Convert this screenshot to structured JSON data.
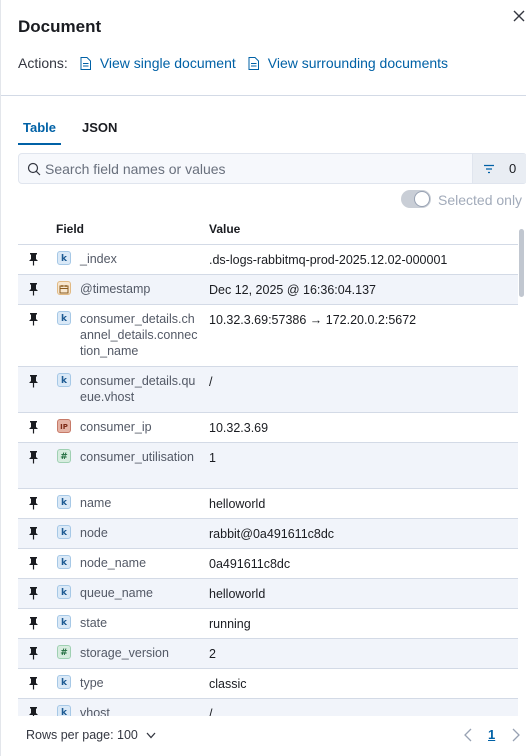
{
  "flyout": {
    "title": "Document",
    "actions_label": "Actions:",
    "view_single": "View single document",
    "view_surrounding": "View surrounding documents"
  },
  "tabs": [
    {
      "label": "Table",
      "active": true
    },
    {
      "label": "JSON",
      "active": false
    }
  ],
  "search": {
    "placeholder": "Search field names or values",
    "filter_count": "0"
  },
  "selected_only_label": "Selected only",
  "table": {
    "headers": {
      "field": "Field",
      "value": "Value"
    },
    "rows": [
      {
        "type_icon": "k",
        "field": "_index",
        "value": ".ds-logs-rabbitmq-prod-2025.12.02-000001"
      },
      {
        "type_icon": "date-icon",
        "field": "@timestamp",
        "value": "Dec 12, 2025 @ 16:36:04.137"
      },
      {
        "type_icon": "k",
        "field": "consumer_details.channel_details.connection_name",
        "value": "10.32.3.69:57386 → 172.20.0.2:5672"
      },
      {
        "type_icon": "k",
        "field": "consumer_details.queue.vhost",
        "value": "/"
      },
      {
        "type_icon": "IP",
        "field": "consumer_ip",
        "value": "10.32.3.69"
      },
      {
        "type_icon": "#",
        "field": "consumer_utilisation",
        "value": "1"
      },
      {
        "type_icon": "k",
        "field": "name",
        "value": "helloworld"
      },
      {
        "type_icon": "k",
        "field": "node",
        "value": "rabbit@0a491611c8dc"
      },
      {
        "type_icon": "k",
        "field": "node_name",
        "value": "0a491611c8dc"
      },
      {
        "type_icon": "k",
        "field": "queue_name",
        "value": "helloworld"
      },
      {
        "type_icon": "k",
        "field": "state",
        "value": "running"
      },
      {
        "type_icon": "#",
        "field": "storage_version",
        "value": "2"
      },
      {
        "type_icon": "k",
        "field": "type",
        "value": "classic"
      },
      {
        "type_icon": "k",
        "field": "vhost",
        "value": "/"
      }
    ]
  },
  "pagination": {
    "rows_per_page": "Rows per page: 100",
    "current_page": "1"
  },
  "colors": {
    "link": "#0061a6",
    "row_alt": "#f1f4fa",
    "border": "#d3dae6"
  }
}
